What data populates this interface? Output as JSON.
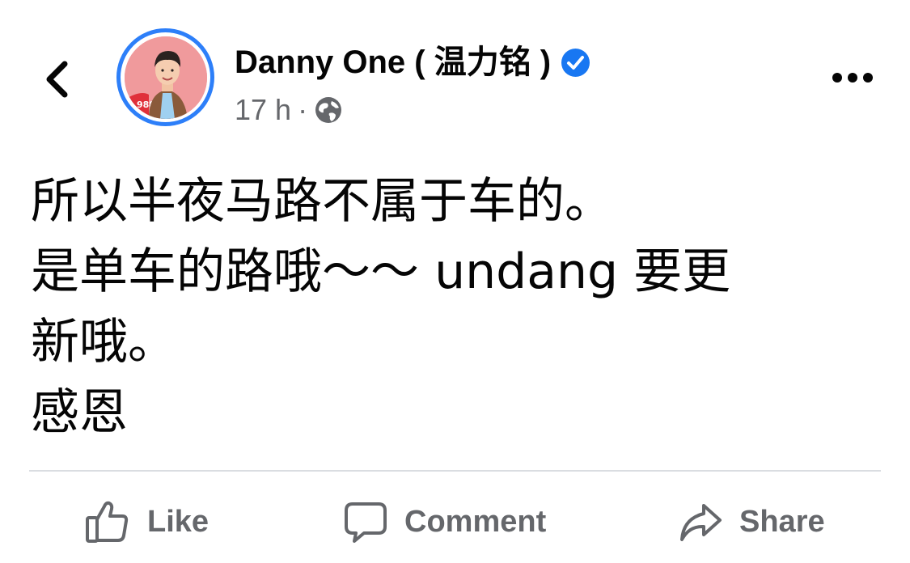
{
  "post": {
    "author_name": "Danny One ( 温力铭 )",
    "verified": true,
    "time": "17 h",
    "separator": "·",
    "audience_icon": "globe-icon",
    "text_lines": [
      "所以半夜马路不属于车的。",
      "是单车的路哦～～ undang 要更",
      "新哦。",
      "感恩"
    ]
  },
  "header": {
    "back_icon": "chevron-left-icon",
    "more_icon": "more-horizontal-icon"
  },
  "actions": {
    "like_label": "Like",
    "comment_label": "Comment",
    "share_label": "Share"
  },
  "colors": {
    "text": "#050505",
    "secondary_text": "#65676b",
    "brand_blue": "#1877f2",
    "avatar_ring": "#2d7ff9",
    "divider": "#dadde1"
  }
}
